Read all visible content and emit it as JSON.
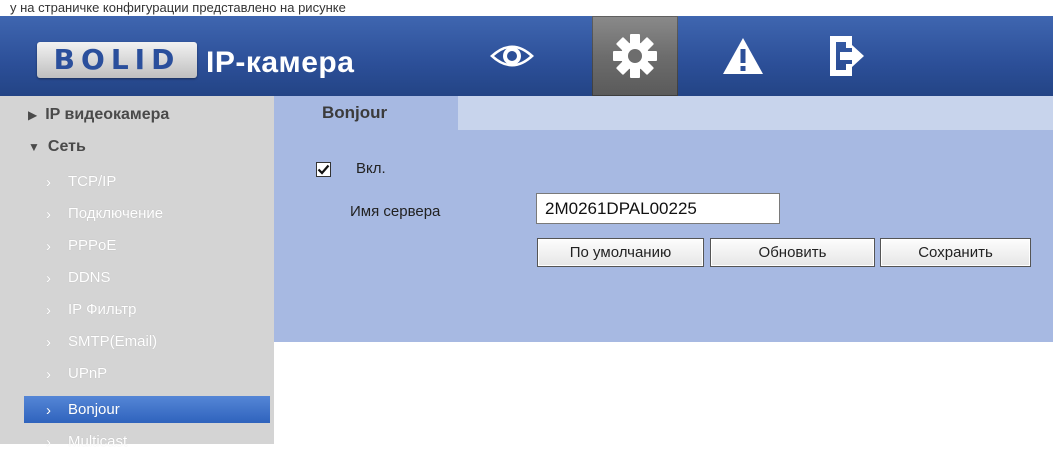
{
  "banner_text": "у на страничке конфигурации представлено на рисунке",
  "header": {
    "logo_text": "BOLID",
    "product_title": "IP-камера",
    "nav": [
      {
        "icon": "eye-icon",
        "active": false
      },
      {
        "icon": "gear-icon",
        "active": true
      },
      {
        "icon": "warning-icon",
        "active": false
      },
      {
        "icon": "logout-icon",
        "active": false
      }
    ]
  },
  "sidebar": {
    "groups": [
      {
        "label": "IP видеокамера",
        "expanded": false
      },
      {
        "label": "Сеть",
        "expanded": true
      }
    ],
    "items": [
      {
        "label": "TCP/IP"
      },
      {
        "label": "Подключение"
      },
      {
        "label": "PPPoE"
      },
      {
        "label": "DDNS"
      },
      {
        "label": "IP Фильтр"
      },
      {
        "label": "SMTP(Email)"
      },
      {
        "label": "UPnP"
      },
      {
        "label": "Bonjour",
        "selected": true
      },
      {
        "label": "Multicast"
      }
    ]
  },
  "content": {
    "tab_label": "Bonjour",
    "enable_label": "Вкл.",
    "enable_checked": true,
    "server_name_label": "Имя сервера",
    "server_name_value": "2M0261DPAL00225",
    "buttons": {
      "default": "По умолчанию",
      "refresh": "Обновить",
      "save": "Сохранить"
    }
  },
  "colors": {
    "header_bg": "#2c4f98",
    "sidebar_bg": "#d4d4d4",
    "selected_item": "#3a6fc8",
    "panel_bg": "#a7b9e2",
    "tabbar_bg": "#c8d4ec"
  }
}
